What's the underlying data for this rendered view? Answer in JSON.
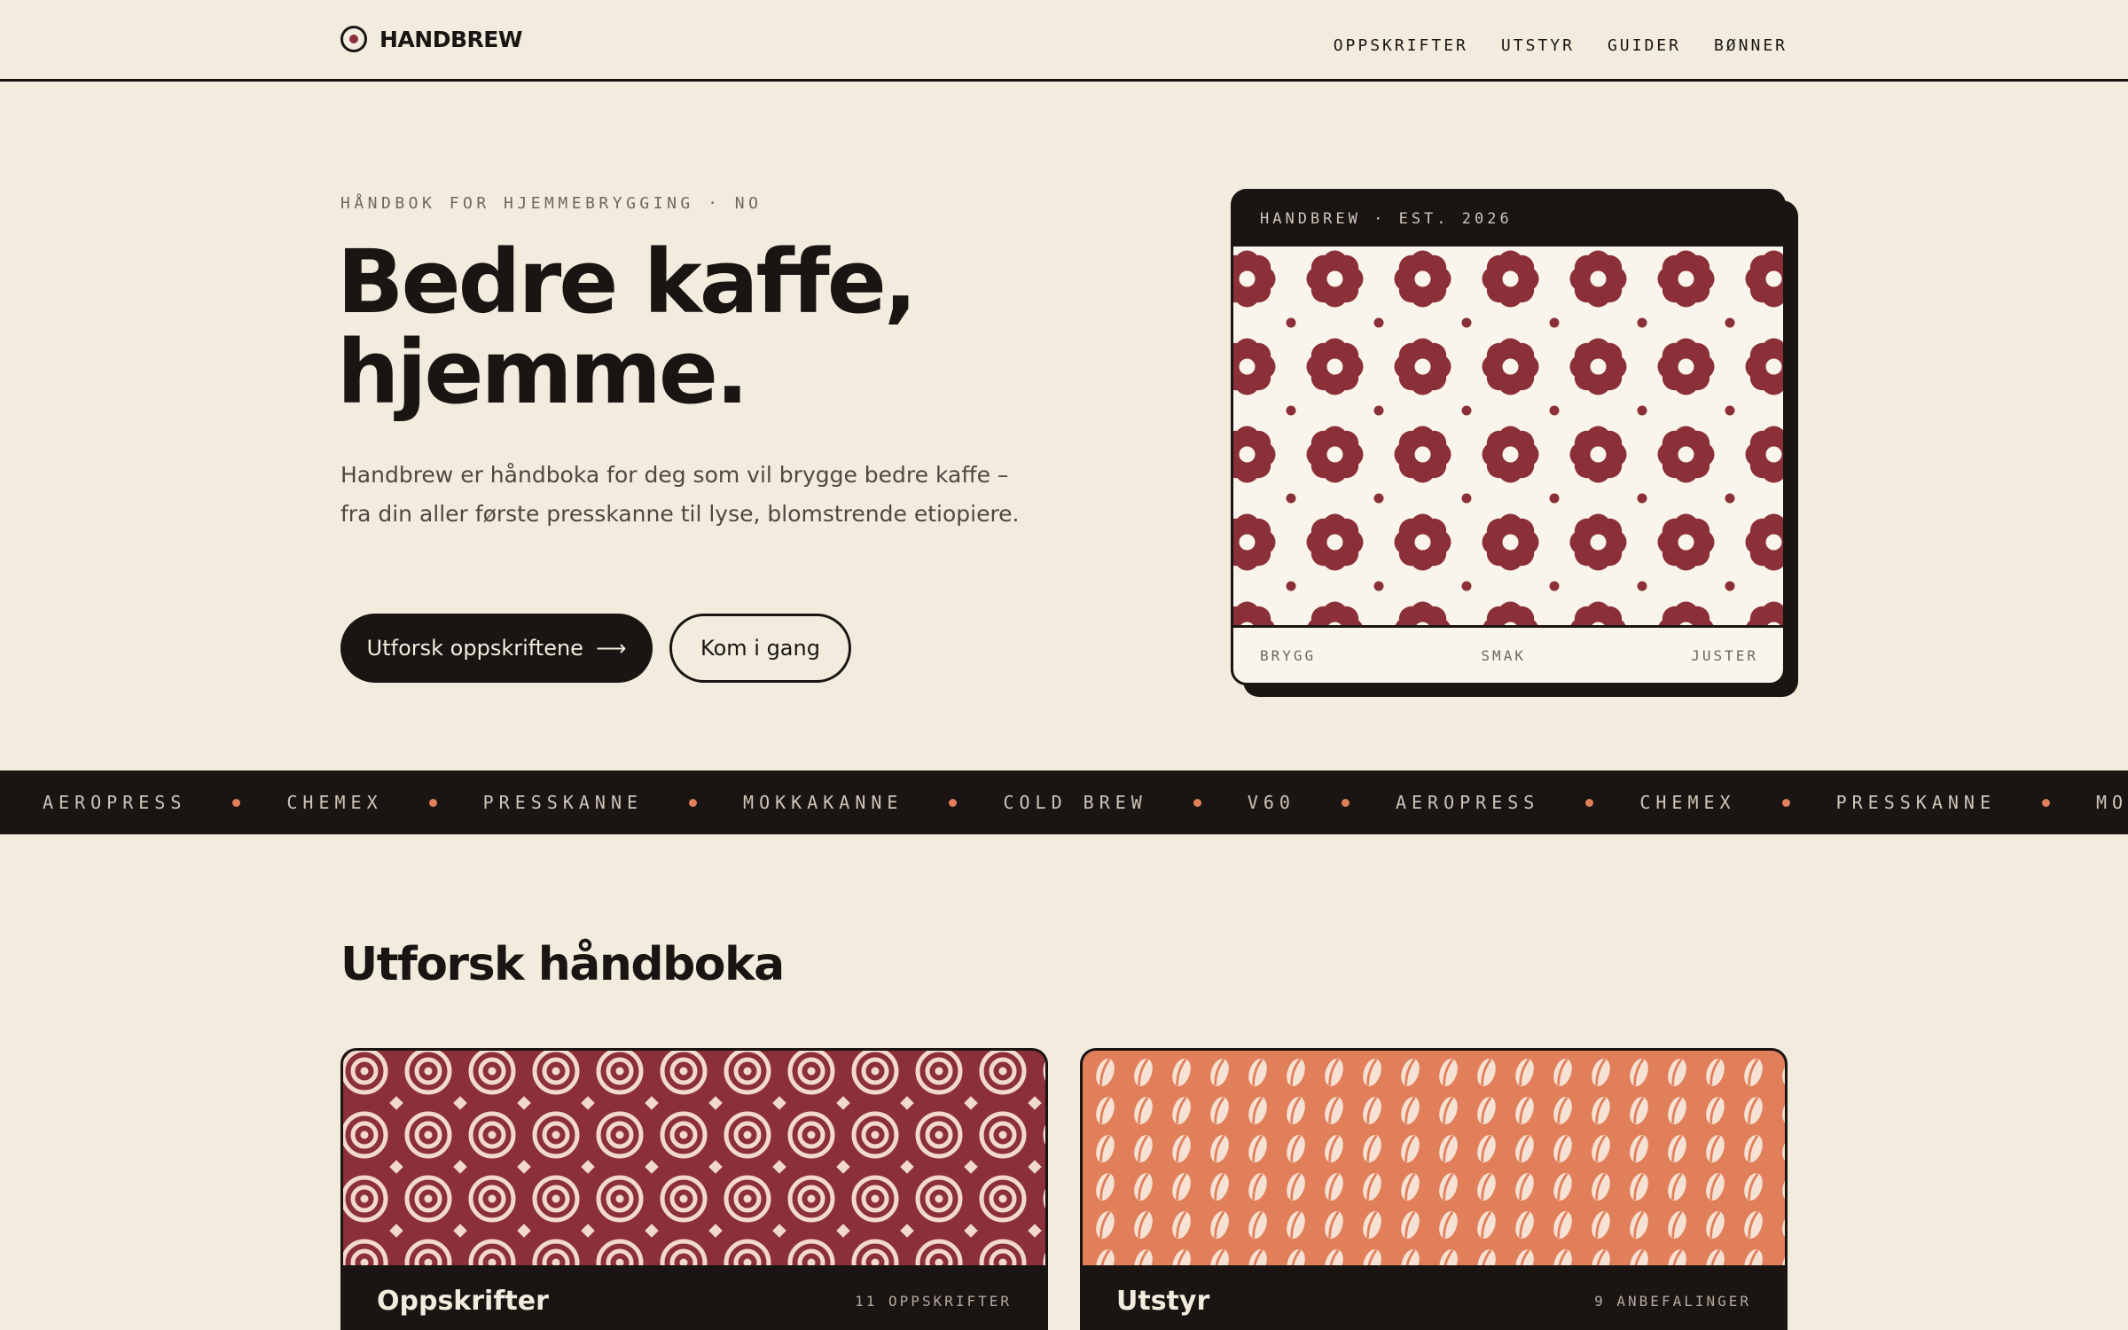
{
  "header": {
    "brand": "HANDBREW",
    "nav": [
      {
        "label": "OPPSKRIFTER"
      },
      {
        "label": "UTSTYR"
      },
      {
        "label": "GUIDER"
      },
      {
        "label": "BØNNER"
      }
    ]
  },
  "hero": {
    "eyebrow": "HÅNDBOK FOR HJEMMEBRYGGING · NO",
    "title_line1": "Bedre kaffe,",
    "title_line2": "hjemme.",
    "description": "Handbrew er håndboka for deg som vil brygge bedre kaffe – fra din aller første presskanne til lyse, blomstrende etiopiere.",
    "primary_button": "Utforsk oppskriftene",
    "primary_button_arrow": "⟶",
    "secondary_button": "Kom i gang",
    "card": {
      "header": "HANDBREW · EST. 2026",
      "footer": [
        "BRYGG",
        "SMAK",
        "JUSTER"
      ]
    }
  },
  "ticker": [
    "AEROPRESS",
    "CHEMEX",
    "PRESSKANNE",
    "MOKKAKANNE",
    "COLD BREW",
    "V60",
    "AEROPRESS",
    "CHEMEX",
    "PRESSKANNE",
    "MOKKAKANNE"
  ],
  "explore": {
    "title": "Utforsk håndboka",
    "cards": [
      {
        "name": "Oppskrifter",
        "count": "11 OPPSKRIFTER"
      },
      {
        "name": "Utstyr",
        "count": "9 ANBEFALINGER"
      }
    ]
  },
  "colors": {
    "background": "#f2ecdf",
    "ink": "#1a1412",
    "wine": "#8b2f38",
    "terracotta": "#e07f5a",
    "cream": "#f9f5ec"
  },
  "icons": {
    "logo": "target-circle-icon",
    "arrow": "arrow-right-icon"
  }
}
